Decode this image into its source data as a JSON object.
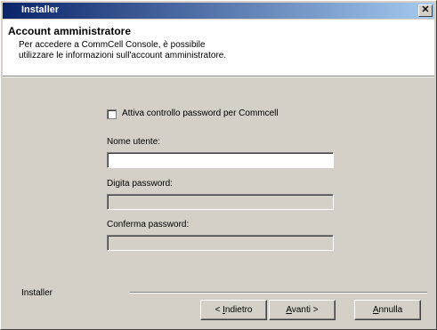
{
  "window": {
    "title": "Installer",
    "close_glyph": "✕"
  },
  "header": {
    "title": "Account amministratore",
    "subtitle_line1": "Per accedere a CommCell Console, è possibile",
    "subtitle_line2": "utilizzare le informazioni sull'account amministratore."
  },
  "form": {
    "enable_password_check_label": "Attiva controllo password per Commcell",
    "enable_password_check_checked": false,
    "username_label": "Nome utente:",
    "username_value": "",
    "password_label": "Digita password:",
    "password_value": "",
    "confirm_label": "Conferma password:",
    "confirm_value": ""
  },
  "footer": {
    "group_label": "Installer",
    "back_prefix": "< ",
    "back_mnemonic": "I",
    "back_rest": "ndietro",
    "next_mnemonic": "A",
    "next_rest": "vanti >",
    "cancel_mnemonic": "A",
    "cancel_rest": "nnulla"
  }
}
